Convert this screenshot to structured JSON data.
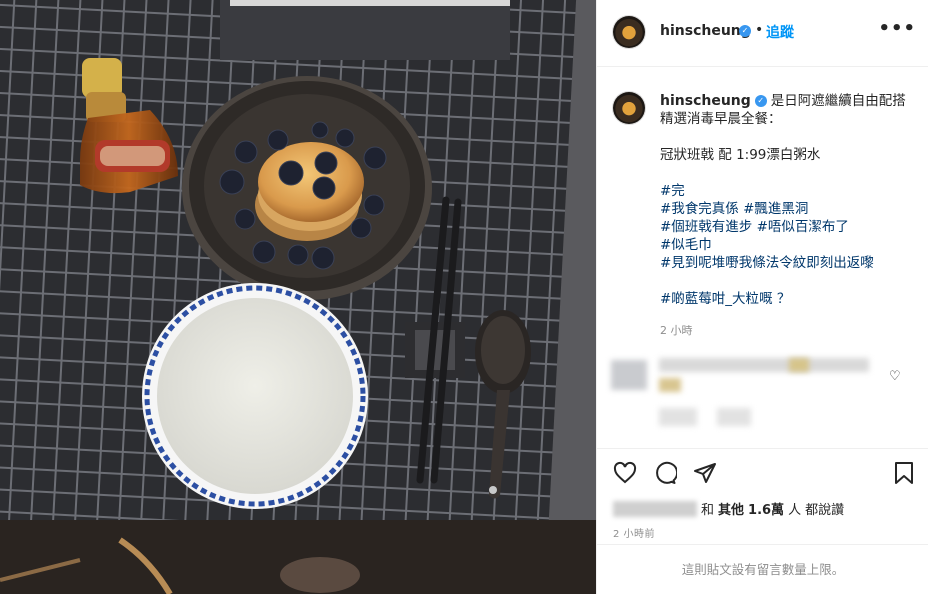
{
  "post": {
    "username": "hinscheung",
    "follow_label": "追蹤",
    "dot": "•",
    "more_icon": "more-horizontal-icon"
  },
  "caption": {
    "username": "hinscheung",
    "line1": "是日阿遮繼續自由配搭",
    "line2": "精選消毒早晨全餐：",
    "line3": "冠狀班戟 配 1:99漂白粥水",
    "tags": [
      "#完",
      "#我食完真係 #飄進黑洞",
      "#個班戟有進步 #唔似百潔布了",
      "#似毛巾",
      "#見到呢堆嘢我條法令紋即刻出返嚟",
      "#啲藍莓咁_大粒嘅 ？"
    ],
    "time": "2 小時"
  },
  "actions": {
    "like_icon": "heart-icon",
    "comment_icon": "comment-icon",
    "share_icon": "paper-plane-icon",
    "save_icon": "bookmark-icon"
  },
  "likes": {
    "and": "和",
    "others": "其他",
    "count": "1.6萬",
    "people": "人",
    "said": "都說讚"
  },
  "post_time": "2 小時前",
  "comment_limit": "這則貼文設有留言數量上限。",
  "colors": {
    "link": "#0095f6",
    "hashtag": "#00376b",
    "muted": "#8e8e8e",
    "verified": "#3897f0"
  }
}
